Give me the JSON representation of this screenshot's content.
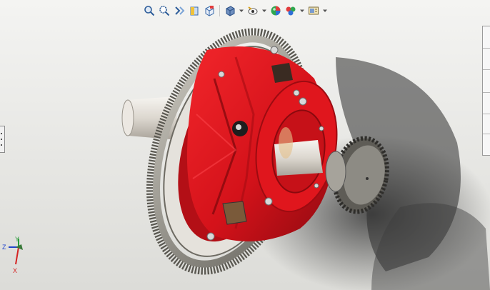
{
  "app": {
    "name": "",
    "document": ""
  },
  "toolbar": {
    "buttons": [
      {
        "icon": "zoom-to-fit-icon"
      },
      {
        "icon": "zoom-to-area-icon"
      },
      {
        "icon": "previous-view-icon"
      },
      {
        "icon": "section-view-icon"
      },
      {
        "icon": "view-orientation-icon"
      },
      {
        "icon": "display-style-icon"
      },
      {
        "icon": "hide-show-items-icon"
      },
      {
        "icon": "edit-appearance-icon"
      },
      {
        "icon": "apply-scene-icon"
      },
      {
        "icon": "view-settings-icon"
      }
    ]
  },
  "triad": {
    "x_label": "X",
    "y_label": "Y",
    "z_label": "Z"
  },
  "model": {
    "description_colors": {
      "housing": "#d8141a",
      "gear": "#9a9a90",
      "shaft": "#e8e4de"
    }
  }
}
